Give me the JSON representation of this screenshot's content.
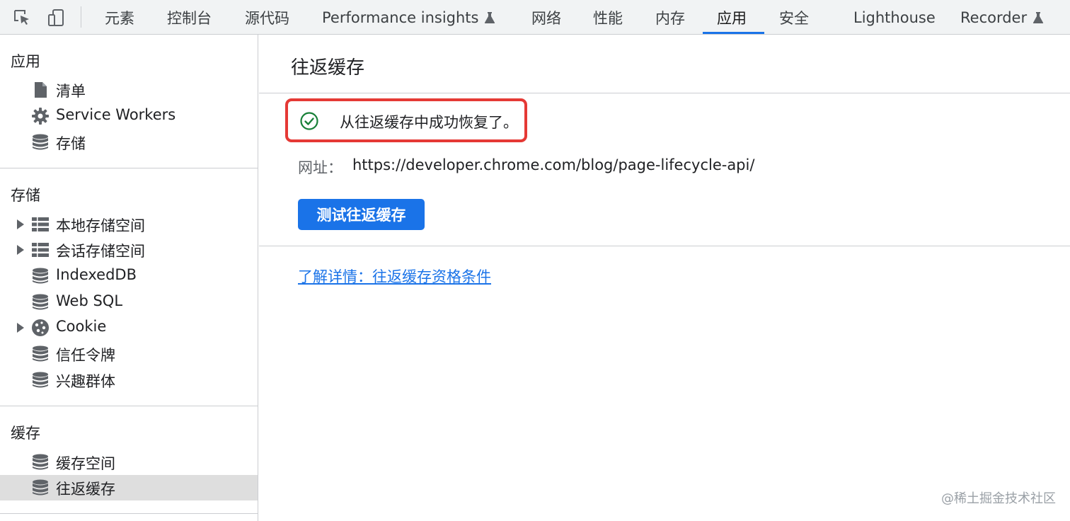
{
  "tabs": [
    {
      "label": "元素"
    },
    {
      "label": "控制台"
    },
    {
      "label": "源代码"
    },
    {
      "label": "Performance insights",
      "experimental": true
    },
    {
      "label": "网络"
    },
    {
      "label": "性能"
    },
    {
      "label": "内存"
    },
    {
      "label": "应用",
      "active": true
    },
    {
      "label": "安全"
    },
    {
      "label": "Lighthouse"
    },
    {
      "label": "Recorder",
      "experimental": true
    }
  ],
  "sidebar": {
    "sections": [
      {
        "title": "应用",
        "items": [
          {
            "label": "清单",
            "icon": "document-icon"
          },
          {
            "label": "Service Workers",
            "icon": "gear-icon"
          },
          {
            "label": "存储",
            "icon": "database-icon"
          }
        ]
      },
      {
        "title": "存储",
        "items": [
          {
            "label": "本地存储空间",
            "icon": "table-icon",
            "expandable": true
          },
          {
            "label": "会话存储空间",
            "icon": "table-icon",
            "expandable": true
          },
          {
            "label": "IndexedDB",
            "icon": "database-icon"
          },
          {
            "label": "Web SQL",
            "icon": "database-icon"
          },
          {
            "label": "Cookie",
            "icon": "cookie-icon",
            "expandable": true
          },
          {
            "label": "信任令牌",
            "icon": "database-icon"
          },
          {
            "label": "兴趣群体",
            "icon": "database-icon"
          }
        ]
      },
      {
        "title": "缓存",
        "items": [
          {
            "label": "缓存空间",
            "icon": "database-icon"
          },
          {
            "label": "往返缓存",
            "icon": "database-icon",
            "selected": true
          }
        ]
      }
    ]
  },
  "main": {
    "title": "往返缓存",
    "status_message": "从往返缓存中成功恢复了。",
    "url_label": "网址：",
    "url_value": "https://developer.chrome.com/blog/page-lifecycle-api/",
    "test_button_label": "测试往返缓存",
    "learn_more_link": "了解详情：往返缓存资格条件"
  },
  "watermark": "@稀土掘金技术社区",
  "colors": {
    "accent": "#1a73e8",
    "success": "#188038",
    "highlight_border": "#e53935",
    "selected_bg": "#dedede"
  }
}
